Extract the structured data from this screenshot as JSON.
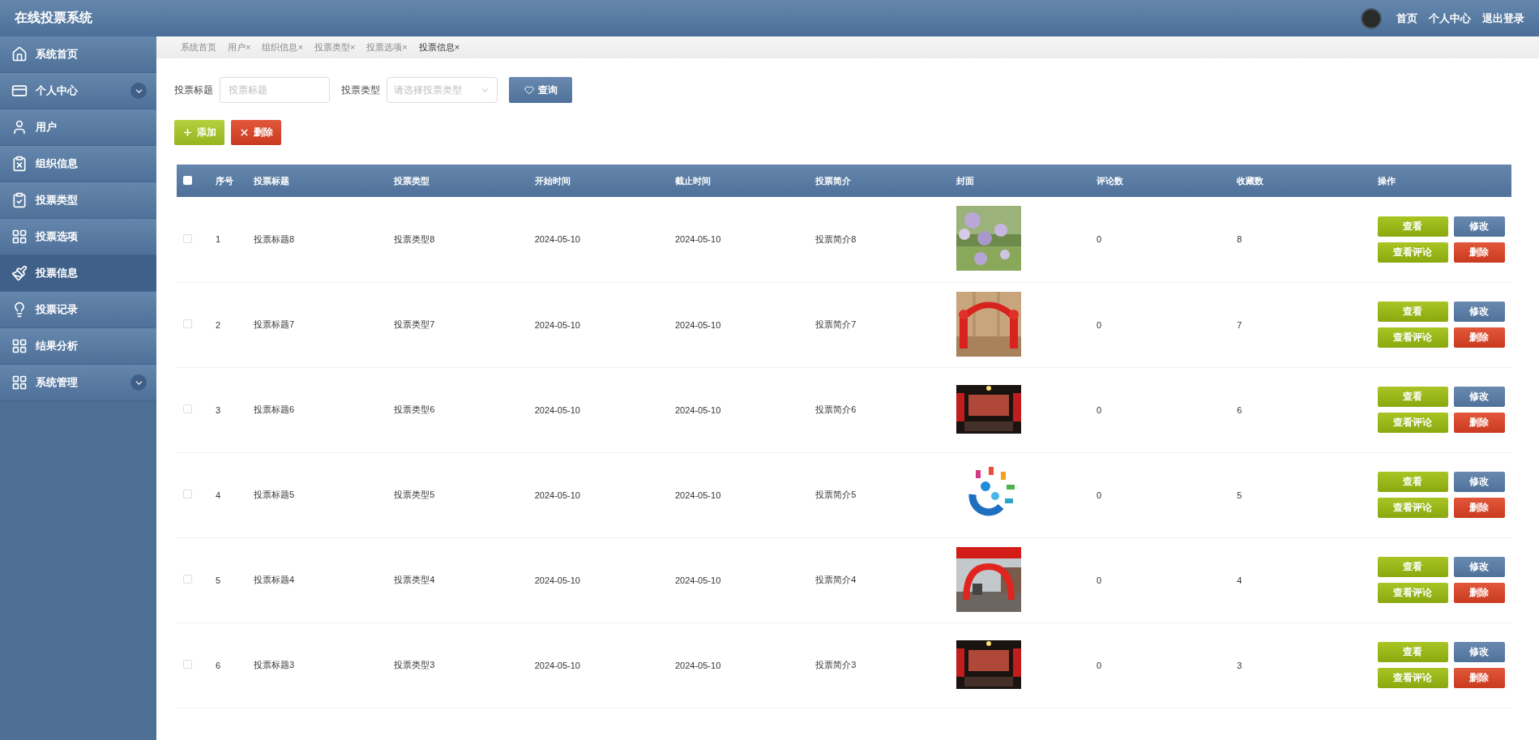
{
  "header": {
    "title": "在线投票系统",
    "nav": [
      "首页",
      "个人中心",
      "退出登录"
    ]
  },
  "sidebar": {
    "items": [
      {
        "label": "系统首页",
        "selected": false,
        "expandable": false
      },
      {
        "label": "个人中心",
        "selected": false,
        "expandable": true
      },
      {
        "label": "用户",
        "selected": false,
        "expandable": false
      },
      {
        "label": "组织信息",
        "selected": false,
        "expandable": false
      },
      {
        "label": "投票类型",
        "selected": false,
        "expandable": false
      },
      {
        "label": "投票选项",
        "selected": false,
        "expandable": false
      },
      {
        "label": "投票信息",
        "selected": true,
        "expandable": false
      },
      {
        "label": "投票记录",
        "selected": false,
        "expandable": false
      },
      {
        "label": "结果分析",
        "selected": false,
        "expandable": false
      },
      {
        "label": "系统管理",
        "selected": false,
        "expandable": true
      }
    ]
  },
  "tabs": [
    {
      "label": "系统首页",
      "selected": false
    },
    {
      "label": "用户",
      "selected": false,
      "close": "×"
    },
    {
      "label": "组织信息",
      "selected": false,
      "close": "×"
    },
    {
      "label": "投票类型",
      "selected": false,
      "close": "×"
    },
    {
      "label": "投票选项",
      "selected": false,
      "close": "×"
    },
    {
      "label": "投票信息",
      "selected": true,
      "close": "×"
    }
  ],
  "search": {
    "title_label": "投票标题",
    "title_placeholder": "投票标题",
    "type_label": "投票类型",
    "type_placeholder": "请选择投票类型",
    "button": "查询"
  },
  "toolbar": {
    "add": "添加",
    "delete": "删除"
  },
  "table": {
    "select_all": {
      "checked": false
    },
    "columns": [
      "序号",
      "投票标题",
      "投票类型",
      "开始时间",
      "截止时间",
      "投票简介",
      "封面",
      "评论数",
      "收藏数",
      "操作"
    ],
    "rows": [
      {
        "checked": false,
        "cells": [
          "1",
          "投票标题8",
          "投票类型8",
          "2024-05-10",
          "2024-05-10",
          "投票简介8"
        ],
        "comments": "0",
        "favorites": "8",
        "actions": [
          {
            "kind": "view",
            "label": "查看"
          },
          {
            "kind": "edit",
            "label": "修改"
          },
          {
            "kind": "view",
            "label": "查看评论"
          },
          {
            "kind": "delete",
            "label": "删除"
          }
        ]
      },
      {
        "checked": false,
        "cells": [
          "2",
          "投票标题7",
          "投票类型7",
          "2024-05-10",
          "2024-05-10",
          "投票简介7"
        ],
        "comments": "0",
        "favorites": "7",
        "actions": [
          {
            "kind": "view",
            "label": "查看"
          },
          {
            "kind": "edit",
            "label": "修改"
          },
          {
            "kind": "view",
            "label": "查看评论"
          },
          {
            "kind": "delete",
            "label": "删除"
          }
        ]
      },
      {
        "checked": false,
        "cells": [
          "3",
          "投票标题6",
          "投票类型6",
          "2024-05-10",
          "2024-05-10",
          "投票简介6"
        ],
        "comments": "0",
        "favorites": "6",
        "actions": [
          {
            "kind": "view",
            "label": "查看"
          },
          {
            "kind": "edit",
            "label": "修改"
          },
          {
            "kind": "view",
            "label": "查看评论"
          },
          {
            "kind": "delete",
            "label": "删除"
          }
        ]
      },
      {
        "checked": false,
        "cells": [
          "4",
          "投票标题5",
          "投票类型5",
          "2024-05-10",
          "2024-05-10",
          "投票简介5"
        ],
        "comments": "0",
        "favorites": "5",
        "actions": [
          {
            "kind": "view",
            "label": "查看"
          },
          {
            "kind": "edit",
            "label": "修改"
          },
          {
            "kind": "view",
            "label": "查看评论"
          },
          {
            "kind": "delete",
            "label": "删除"
          }
        ]
      },
      {
        "checked": false,
        "cells": [
          "5",
          "投票标题4",
          "投票类型4",
          "2024-05-10",
          "2024-05-10",
          "投票简介4"
        ],
        "comments": "0",
        "favorites": "4",
        "actions": [
          {
            "kind": "view",
            "label": "查看"
          },
          {
            "kind": "edit",
            "label": "修改"
          },
          {
            "kind": "view",
            "label": "查看评论"
          },
          {
            "kind": "delete",
            "label": "删除"
          }
        ]
      },
      {
        "checked": false,
        "cells": [
          "6",
          "投票标题3",
          "投票类型3",
          "2024-05-10",
          "2024-05-10",
          "投票简介3"
        ],
        "comments": "0",
        "favorites": "3",
        "actions": [
          {
            "kind": "view",
            "label": "查看"
          },
          {
            "kind": "edit",
            "label": "修改"
          },
          {
            "kind": "view",
            "label": "查看评论"
          },
          {
            "kind": "delete",
            "label": "删除"
          }
        ]
      }
    ]
  }
}
